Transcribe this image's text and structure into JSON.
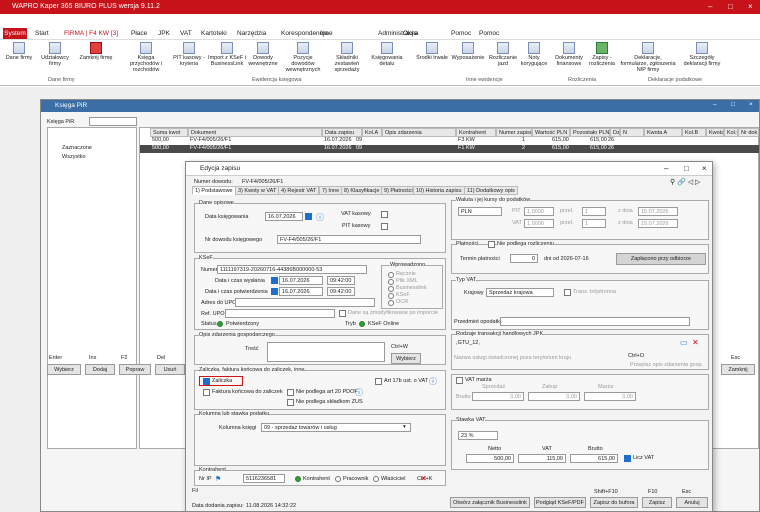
{
  "window": {
    "title": "WAPRO Kaper 365 BIURO PLUS wersja 9.11.2"
  },
  "menu": {
    "system": "System",
    "items": [
      "Start",
      "FIRMA | F4 KW [3]",
      "Płace",
      "JPK",
      "VAT",
      "Kartoteki",
      "Narzędzia",
      "Korespondencja",
      "Inne",
      "Administracja",
      "Okna",
      "Pomoc"
    ]
  },
  "ribbon": {
    "buttons": [
      "Dane firmy",
      "Udziałowcy firmy",
      "Zamknij firmę",
      "Księga przychodów i rozchodów",
      "PIT kasowy - kryteria",
      "Import z KSeF i BusinessLink",
      "Dowody wewnętrzne",
      "Pozycje dowodów wewnętrznych",
      "Składniki zestawień sprzedaży",
      "Księgowania detalu",
      "Środki trwałe",
      "Wyposażenie",
      "Rozliczanie jazd",
      "Noty korygujące",
      "Dokumenty finansowe",
      "Zapisy - rozliczenia",
      "Deklaracje, formularze, zgłoszenia NIP firmy",
      "Szczegóły deklaracji firmy"
    ],
    "groups": [
      "Dane firmy",
      "Ewidencja księgowa",
      "Inne ewidencje",
      "Rozliczenia",
      "Deklaracje podatkowe"
    ]
  },
  "kpir": {
    "title": "Księga PiR",
    "filter_label": "Księga PiR",
    "tree": [
      "Zaznaczone",
      "Wszystko"
    ],
    "columns": [
      "Suma kwot",
      "Dokument",
      "Data zapisu",
      "Kol.A",
      "Opis zdarzenia",
      "Kontrahent",
      "Numer zapisu",
      "Wartość PLN",
      "Pozostało PLN",
      "Dz",
      "N",
      "Kwota A",
      "Kol.B",
      "Kwota",
      "Kol.C",
      "Nr dok"
    ],
    "rows": [
      [
        "500,00",
        "FV-F4/005/26/F1",
        "16.07.2026",
        "09",
        "",
        "F3 KW",
        "1",
        "615,00",
        "615,00",
        "26",
        "",
        "",
        "",
        "",
        "",
        ""
      ],
      [
        "500,00",
        "FV-F4/005/26/F1",
        "16.07.2026",
        "09",
        "",
        "F1 KW",
        "2",
        "615,00",
        "615,00",
        "26",
        "",
        "",
        "",
        "",
        "",
        ""
      ]
    ],
    "keys": [
      "Enter",
      "Ins",
      "F2",
      "Del"
    ],
    "buttons": [
      "Wybierz",
      "Dodaj",
      "Popraw",
      "Usuń"
    ],
    "esc": "Esc",
    "close": "Zamknij"
  },
  "edit": {
    "title": "Edycja zapisu",
    "doc_label": "Numer dowodu:",
    "doc_value": "FV-F4/005/26/F1",
    "tabs": [
      "1) Podstawowe",
      "3) Kwoty w VAT",
      "4) Rejestr VAT",
      "7) Inne",
      "8) Klasyfikacje",
      "9) Płatności",
      "10) Historia zapisu",
      "11) Dodatkowy opis"
    ],
    "dane": {
      "title": "Dane opisowe",
      "data_ksieg_label": "Data księgowania",
      "data_ksieg": "16.07.2026",
      "vat_kasowy": "VAT kasowy",
      "pit_kasowy": "PIT kasowy",
      "nr_label": "Nr dowodu księgowego",
      "nr_value": "FV-F4/005/26/F1"
    },
    "ksef": {
      "title": "KSeF",
      "numer_label": "Numer",
      "numer": "1111197319-20260716-44386B000000-53",
      "wyst_label": "Data i czas wysłania",
      "wyst_date": "16.07.2026",
      "wyst_time": "09:42:00",
      "potw_label": "Data i czas potwierdzenia",
      "potw_date": "16.07.2026",
      "potw_time": "09:42:00",
      "upo_label": "Adres do UPO",
      "ref_label": "Ref. UPO",
      "dane_zmod": "Dane są zmodyfikowane po imporcie",
      "status_label": "Status",
      "status_value": "Potwierdzony",
      "tryb_label": "Tryb",
      "tryb_value": "KSeF Online",
      "wprow_title": "Wprowadzono",
      "wprow_options": [
        "Ręcznie",
        "Plik XML",
        "Businesslink",
        "KSeF",
        "OCR"
      ]
    },
    "opis": {
      "title": "Opis zdarzenia gospodarczego",
      "tresc_label": "Treść",
      "ctrl": "Ctrl+W",
      "wybierz": "Wybierz"
    },
    "zal": {
      "title": "Zaliczka, faktura końcowa do zaliczek, inne",
      "zaliczka": "Zaliczka",
      "art17": "Art 17b ust. o VAT",
      "fakt_konc": "Faktura końcowa do zaliczek",
      "nie_art20": "Nie podlega art 20 PDOF",
      "nie_zus": "Nie podlega składkom ZUS"
    },
    "kol": {
      "title": "Kolumna lub stawka podatku",
      "label": "Kolumna księgi",
      "value": "09 - sprzedaż towarów i usług"
    },
    "kontr": {
      "title": "Kontrahent",
      "nip_label": "Nr IP",
      "nip": "5116236581",
      "kontrahent": "Kontrahent",
      "pracownik": "Pracownik",
      "wlasciciel": "Właściciel",
      "ctrl": "Ctrl+K"
    },
    "waluta": {
      "title": "Waluta i jej kursy do podatków",
      "cur": "PLN",
      "pit": "PIT",
      "vat": "VAT",
      "kurs": "1,0000",
      "przel": "przel.",
      "mult": "1",
      "z_dnia": "z dnia",
      "date": "15.07.2026"
    },
    "platn": {
      "title": "Płatności",
      "nie_podlega": "Nie podlega rozliczeniu",
      "termin_label": "Termin płatności",
      "termin": "0",
      "dni": "dni od 2026-07-16",
      "zaplacono": "Zapłacono przy odbiorze"
    },
    "typ": {
      "title": "Typ VAT",
      "krajowy_label": "Krajowy",
      "krajowy": "Sprzedaż krajowa",
      "trans": "Trans. trójstronna",
      "przedmiot": "Przedmiot opodatkow."
    },
    "rodz": {
      "title": "Rodzaje transakcji handlowych JPK",
      "value": ",GTU_12,",
      "nazwa_placeholder": "Nazwa usługi świadczonej poza terytorium kraju",
      "ctrlo": "Ctrl+O",
      "przepisz": "Przepisz opis zdarzenia gosp."
    },
    "marza": {
      "title": "VAT marża",
      "zakup": "Zakup",
      "sprzedaz": "Sprzedaż",
      "marza": "Marża",
      "brutto": "Brutto",
      "zero": "0,00"
    },
    "stawka": {
      "title": "Stawka VAT",
      "value": "23 %",
      "netto_label": "Netto",
      "netto": "500,00",
      "vat_label": "VAT",
      "vat": "115,00",
      "brutto_label": "Brutto",
      "brutto": "615,00",
      "liczvat": "Licz VAT"
    },
    "footer": {
      "data_label": "Data dodania zapisu:",
      "data": "11.08.2026 14:32:22",
      "fil": "Fil",
      "keys": [
        "Shift+F10",
        "F10",
        "Esc"
      ],
      "buttons": [
        "Otwórz załącznik Businesslink",
        "Podgląd KSeF/PDF",
        "Zapisz do bufora",
        "Zapisz",
        "Anuluj"
      ]
    }
  }
}
